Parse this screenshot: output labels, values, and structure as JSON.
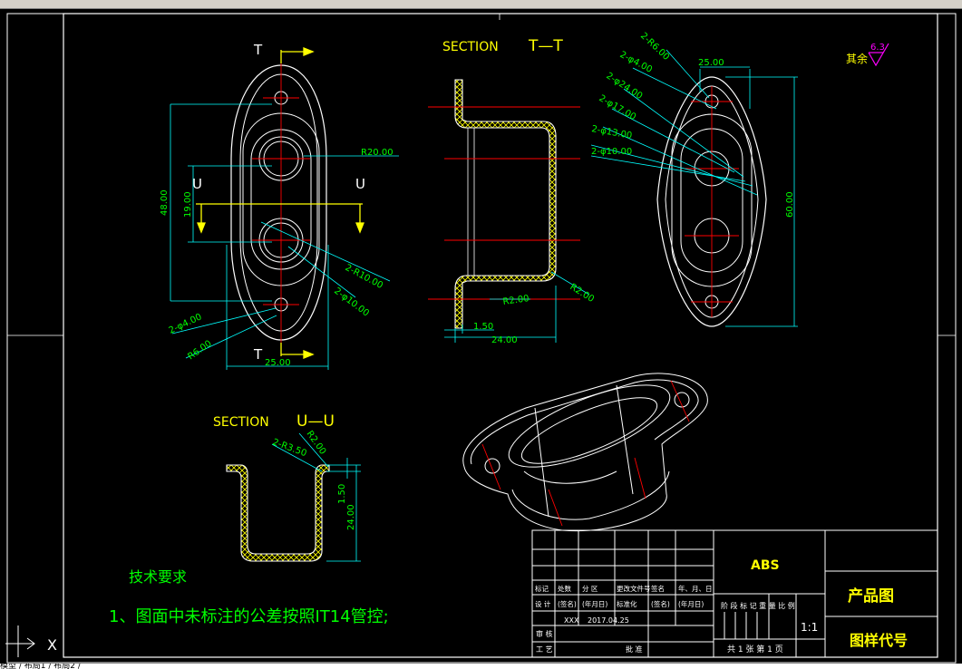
{
  "window": {
    "status_text": "模型 / 布局1 / 布局2 /"
  },
  "colors": {
    "background": "#000000",
    "outline": "#ffffff",
    "dimension": "#00ffff",
    "dim_text": "#00ff00",
    "centerline": "#ff0000",
    "label": "#ffff00",
    "roughness": "#ff00ff",
    "hatch": "#ffff00"
  },
  "section_titles": {
    "tt_prefix": "SECTION",
    "tt_suffix": "T—T",
    "uu_prefix": "SECTION",
    "uu_suffix": "U—U"
  },
  "view_labels": {
    "t_top": "T",
    "t_bottom": "T",
    "u_left": "U",
    "u_right": "U"
  },
  "roughness": {
    "prefix": "其余",
    "value": "6.3"
  },
  "front_view_dims": {
    "r20": "R20.00",
    "d48": "48.00",
    "d19": "19.00",
    "r10": "2-R10.00",
    "phi10": "2-φ10.00",
    "phi4": "2-φ4.00",
    "r6": "R6.00",
    "w25": "25.00"
  },
  "section_tt_dims": {
    "r2_inner": "R2.00",
    "r2_outer": "R2.00",
    "t150": "1.50",
    "w24": "24.00"
  },
  "right_view_dims": {
    "r6": "2-R6.00",
    "phi4": "2-φ4.00",
    "phi24": "2-φ24.00",
    "phi17": "2-φ17.00",
    "phi13": "2-φ13.00",
    "phi10": "2-φ10.00",
    "w25": "25.00",
    "h60": "60.00"
  },
  "section_uu_dims": {
    "r350": "2-R3.50",
    "r2": "R2.00",
    "t150": "1.50",
    "h24": "24.00"
  },
  "technical_notes": {
    "heading": "技术要求",
    "line1": "1、图面中未标注的公差按照IT14管控;"
  },
  "title_block": {
    "material": "ABS",
    "product_name": "产品图",
    "drawing_number": "图样代号",
    "scale": "1:1",
    "headers": [
      "标记",
      "处数",
      "分 区",
      "更改文件号",
      "签名",
      "年、月、日"
    ],
    "design_row": [
      "设 计",
      "(签名)",
      "(年月日)",
      "标准化",
      "(签名)",
      "(年月日)"
    ],
    "designer": "XXX",
    "date": "2017.04.25",
    "stage_header": "阶 段 标 记   重 量   比 例",
    "review": "审 核",
    "process": "工 艺",
    "approve": "批 准",
    "sheets": "共 1 张   第 1 页"
  },
  "ucs": {
    "axis": "X"
  }
}
